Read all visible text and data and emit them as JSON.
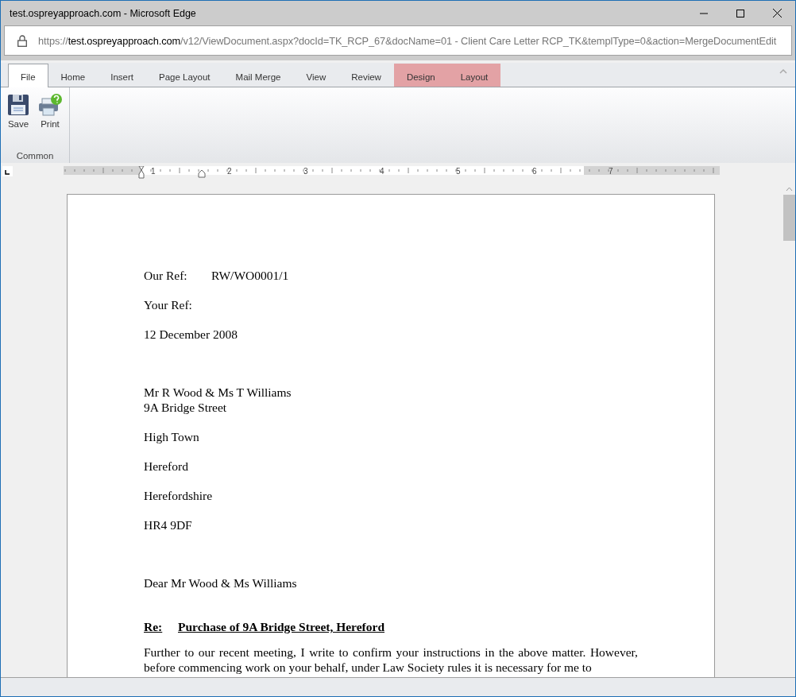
{
  "window": {
    "title": "test.ospreyapproach.com - Microsoft Edge"
  },
  "address_bar": {
    "prefix": "https://",
    "domain": "test.ospreyapproach.com",
    "path": "/v12/ViewDocument.aspx?docId=TK_RCP_67&docName=01 - Client Care Letter RCP_TK&templType=0&action=MergeDocumentEdit"
  },
  "tabs": [
    {
      "label": "File",
      "selected": true,
      "kind": "normal"
    },
    {
      "label": "Home",
      "selected": false,
      "kind": "normal"
    },
    {
      "label": "Insert",
      "selected": false,
      "kind": "normal"
    },
    {
      "label": "Page Layout",
      "selected": false,
      "kind": "normal"
    },
    {
      "label": "Mail Merge",
      "selected": false,
      "kind": "normal"
    },
    {
      "label": "View",
      "selected": false,
      "kind": "normal"
    },
    {
      "label": "Review",
      "selected": false,
      "kind": "normal"
    },
    {
      "label": "Design",
      "selected": false,
      "kind": "contextual"
    },
    {
      "label": "Layout",
      "selected": false,
      "kind": "contextual"
    }
  ],
  "ribbon": {
    "groups": [
      {
        "label": "Common",
        "buttons": [
          {
            "label": "Save",
            "kind": "save"
          },
          {
            "label": "Print",
            "kind": "print"
          }
        ]
      }
    ]
  },
  "ruler": {
    "labels": [
      "1",
      "2",
      "3",
      "4",
      "5",
      "6",
      "7"
    ]
  },
  "document": {
    "paragraphs": [
      {
        "kind": "ref",
        "label": "Our Ref:",
        "text": "RW/WO0001/1"
      },
      {
        "kind": "text",
        "lines": [
          "Your Ref:"
        ]
      },
      {
        "kind": "text",
        "lines": [
          "12 December 2008"
        ]
      },
      {
        "kind": "blank"
      },
      {
        "kind": "text",
        "lines": [
          "Mr R Wood & Ms T Williams",
          "9A Bridge Street"
        ]
      },
      {
        "kind": "text",
        "lines": [
          "High Town"
        ]
      },
      {
        "kind": "text",
        "lines": [
          "Hereford"
        ]
      },
      {
        "kind": "text",
        "lines": [
          "Herefordshire"
        ]
      },
      {
        "kind": "text",
        "lines": [
          "HR4 9DF"
        ]
      },
      {
        "kind": "blank"
      },
      {
        "kind": "text",
        "lines": [
          "Dear Mr Wood & Ms Williams"
        ]
      },
      {
        "kind": "heading",
        "label": "Re:",
        "text": "Purchase of 9A Bridge Street, Hereford"
      },
      {
        "kind": "body",
        "text": "Further to our recent meeting, I write to confirm your instructions in the above matter.  However, before commencing work on your behalf, under Law Society rules it is necessary for me to"
      }
    ]
  }
}
